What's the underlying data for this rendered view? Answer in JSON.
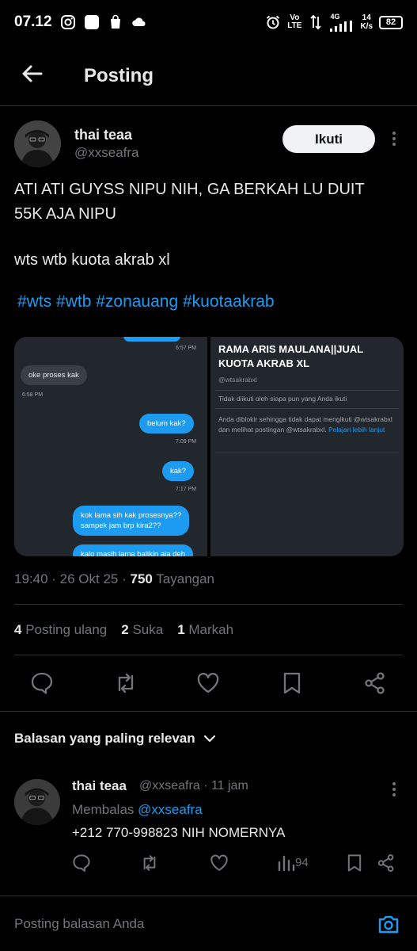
{
  "status_bar": {
    "time": "07.12",
    "network_top": "Vo",
    "network_bottom": "LTE",
    "gen": "4G",
    "speed_top": "14",
    "speed_bottom": "K/s",
    "battery": "82"
  },
  "header": {
    "title": "Posting"
  },
  "post": {
    "author_name": "thai teaa",
    "author_handle": "@xxseafra",
    "follow_label": "Ikuti",
    "text_line1": "ATI ATI GUYSS NIPU NIH, GA BERKAH LU DUIT",
    "text_line2": "55K AJA NIPU",
    "text_line3": "wts wtb kuota akrab xl",
    "hashtags": "#wts #wtb #zonauang #kuotaakrab",
    "time": "19:40",
    "date": "26 Okt 25",
    "views_count": "750",
    "views_label": "Tayangan",
    "reposts_count": "4",
    "reposts_label": "Posting ulang",
    "likes_count": "2",
    "likes_label": "Suka",
    "bookmarks_count": "1",
    "bookmarks_label": "Markah"
  },
  "media": {
    "chat": {
      "ts1": "6:57 PM",
      "msg1": "oke proses kak",
      "ts2": "6:58 PM",
      "msg2": "belum kak?",
      "ts3": "7:09 PM",
      "msg3": "kak?",
      "ts4": "7:17 PM",
      "msg4_line1": "kok lama sih kak prosesnya??",
      "msg4_line2": "sampek jam brp kira2??",
      "msg5": "kalo masih lama balikin aja deh"
    },
    "profile": {
      "name": "RAMA ARIS MAULANA||JUAL KUOTA AKRAB XL",
      "handle": "@wtsakrabxl",
      "not_followed": "Tidak diikuti oleh siapa pun yang Anda ikuti",
      "blocked_text": "Anda diblokir sehingga tidak dapat mengikuti @wtsakrabxl dan melihat postingan @wtsakrabxl.",
      "learn_more": "Pelajari lebih lanjut"
    }
  },
  "sort": {
    "label": "Balasan yang paling relevan"
  },
  "reply": {
    "author_name": "thai teaa",
    "author_handle": "@xxseafra",
    "time_ago": "· 11 jam",
    "replying_label": "Membalas",
    "replying_to": "@xxseafra",
    "text": "+212 770-998823 NIH NOMERNYA",
    "views": "94"
  },
  "composer": {
    "placeholder": "Posting balasan Anda"
  },
  "colors": {
    "accent": "#1d9bf0",
    "background": "#000000",
    "muted": "#71767b"
  },
  "icons": [
    "back-arrow-icon",
    "reply-icon",
    "repost-icon",
    "like-icon",
    "bookmark-icon",
    "share-icon",
    "views-icon",
    "camera-icon",
    "chevron-down-icon",
    "more-icon"
  ]
}
